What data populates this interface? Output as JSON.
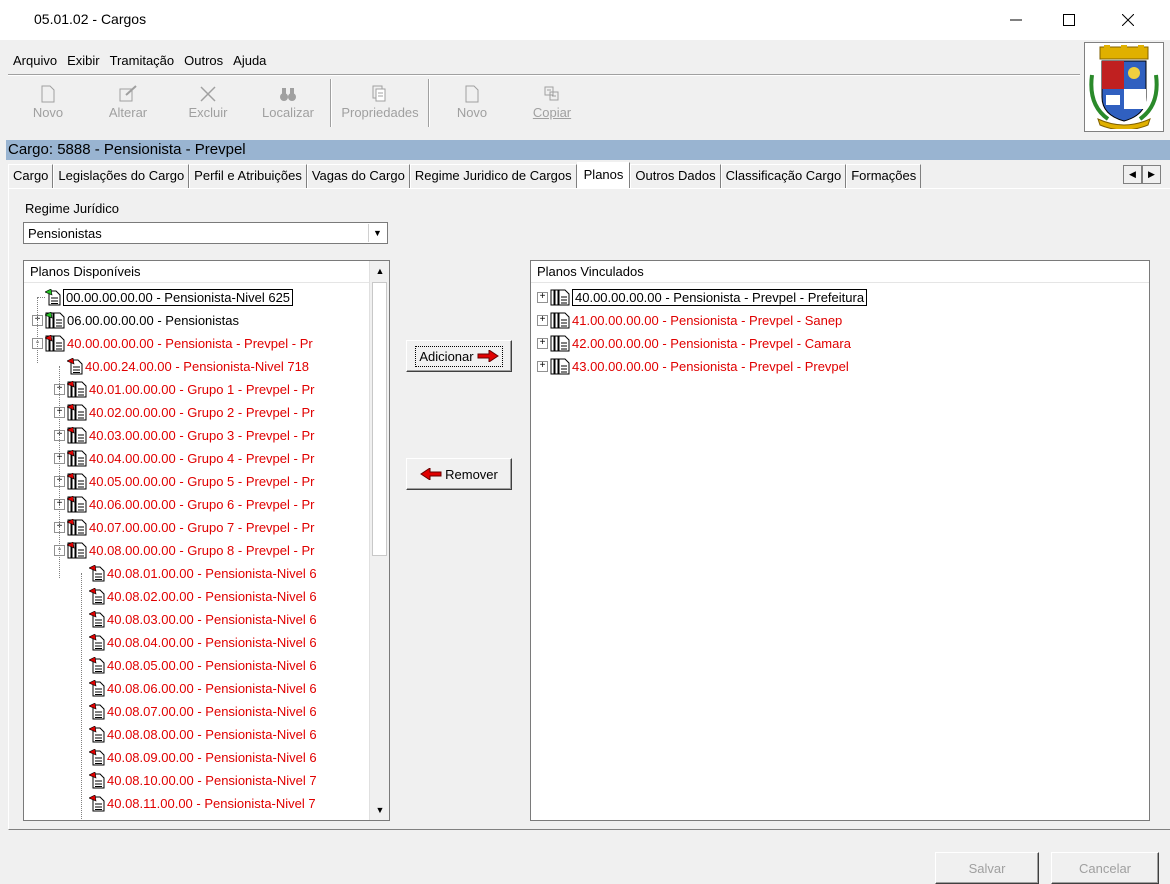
{
  "window": {
    "title": "05.01.02 - Cargos"
  },
  "menu": {
    "items": [
      "Arquivo",
      "Exibir",
      "Tramitação",
      "Outros",
      "Ajuda"
    ]
  },
  "toolbar": {
    "novo": "Novo",
    "alterar": "Alterar",
    "excluir": "Excluir",
    "localizar": "Localizar",
    "propriedades": "Propriedades",
    "novo2": "Novo",
    "copiar": "Copiar"
  },
  "cargo_header": "Cargo: 5888 - Pensionista - Prevpel",
  "tabs": [
    "Cargo",
    "Legislações do Cargo",
    "Perfil e Atribuições",
    "Vagas do Cargo",
    "Regime Juridico de Cargos",
    "Planos",
    "Outros Dados",
    "Classificação Cargo",
    "Formações"
  ],
  "active_tab": "Planos",
  "regime": {
    "label": "Regime Jurídico",
    "value": "Pensionistas"
  },
  "left_list": {
    "header": "Planos Disponíveis",
    "items": [
      "00.00.00.00.00 - Pensionista-Nivel 625",
      "06.00.00.00.00 - Pensionistas",
      "40.00.00.00.00 - Pensionista - Prevpel - Pr",
      "40.00.24.00.00 - Pensionista-Nivel 718",
      "40.01.00.00.00 - Grupo 1 - Prevpel - Pr",
      "40.02.00.00.00 - Grupo 2 - Prevpel - Pr",
      "40.03.00.00.00 - Grupo 3 - Prevpel - Pr",
      "40.04.00.00.00 - Grupo 4 - Prevpel - Pr",
      "40.05.00.00.00 - Grupo 5 - Prevpel - Pr",
      "40.06.00.00.00 - Grupo 6 - Prevpel - Pr",
      "40.07.00.00.00 - Grupo 7 - Prevpel - Pr",
      "40.08.00.00.00 - Grupo 8 - Prevpel - Pr",
      "40.08.01.00.00 - Pensionista-Nivel 6",
      "40.08.02.00.00 - Pensionista-Nivel 6",
      "40.08.03.00.00 - Pensionista-Nivel 6",
      "40.08.04.00.00 - Pensionista-Nivel 6",
      "40.08.05.00.00 - Pensionista-Nivel 6",
      "40.08.06.00.00 - Pensionista-Nivel 6",
      "40.08.07.00.00 - Pensionista-Nivel 6",
      "40.08.08.00.00 - Pensionista-Nivel 6",
      "40.08.09.00.00 - Pensionista-Nivel 6",
      "40.08.10.00.00 - Pensionista-Nivel 7",
      "40.08.11.00.00 - Pensionista-Nivel 7"
    ]
  },
  "right_list": {
    "header": "Planos Vinculados",
    "items": [
      "40.00.00.00.00 - Pensionista - Prevpel - Prefeitura",
      "41.00.00.00.00 - Pensionista - Prevpel - Sanep",
      "42.00.00.00.00 - Pensionista - Prevpel - Camara",
      "43.00.00.00.00 - Pensionista - Prevpel - Prevpel"
    ]
  },
  "buttons": {
    "adicionar": "Adicionar",
    "remover": "Remover",
    "salvar": "Salvar",
    "cancelar": "Cancelar"
  },
  "colors": {
    "header_bg": "#99b4d1",
    "red_text": "#e00000",
    "green_icon": "#22c022"
  }
}
